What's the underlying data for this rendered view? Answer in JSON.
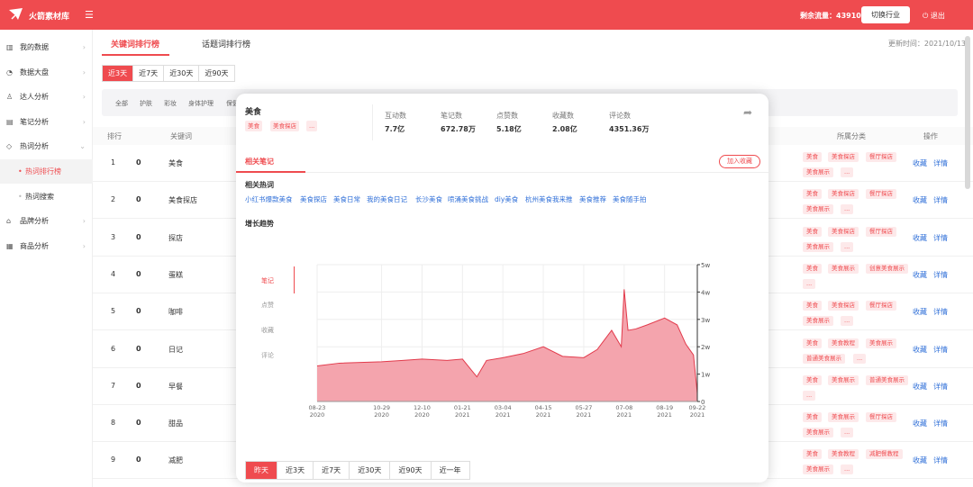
{
  "topbar": {
    "logo_text": "火箭素材库",
    "menu_icon": "☰",
    "credits": "剩余流量：43910",
    "switch": "切换行业",
    "logout": "退出"
  },
  "sidebar": {
    "items": [
      {
        "icon": "bar-chart-icon",
        "label": "我的数据"
      },
      {
        "icon": "pie-icon",
        "label": "数据大盘"
      },
      {
        "icon": "user-icon",
        "label": "达人分析"
      },
      {
        "icon": "note-icon",
        "label": "笔记分析"
      },
      {
        "icon": "tag-icon",
        "label": "热词分析"
      },
      {
        "icon": "",
        "label": "热词排行榜"
      },
      {
        "icon": "",
        "label": "热词搜索"
      },
      {
        "icon": "brand-icon",
        "label": "品牌分析"
      },
      {
        "icon": "shop-icon",
        "label": "商品分析"
      }
    ]
  },
  "tabs": [
    "关键词排行榜",
    "话题词排行榜"
  ],
  "update_time": "更新时间：2021/10/13",
  "ranges": [
    "近3天",
    "近7天",
    "近30天",
    "近90天"
  ],
  "categories": [
    "全部",
    "护肤",
    "彩妆",
    "身体护理",
    "保健"
  ],
  "table": {
    "headers": {
      "rank": "排行",
      "keyword": "关键词",
      "category": "所属分类",
      "op": "操作"
    },
    "rows": [
      {
        "rank": "1",
        "change": "0",
        "keyword": "美食",
        "tags": [
          "美食",
          "美食探店",
          "餐厅探店",
          "美食展示",
          "..."
        ]
      },
      {
        "rank": "2",
        "change": "0",
        "keyword": "美食探店",
        "tags": [
          "美食",
          "美食探店",
          "餐厅探店",
          "美食展示",
          "..."
        ]
      },
      {
        "rank": "3",
        "change": "0",
        "keyword": "探店",
        "tags": [
          "美食",
          "美食探店",
          "餐厅探店",
          "美食展示",
          "..."
        ]
      },
      {
        "rank": "4",
        "change": "0",
        "keyword": "蛋糕",
        "tags": [
          "美食",
          "美食展示",
          "创意美食展示",
          "..."
        ]
      },
      {
        "rank": "5",
        "change": "0",
        "keyword": "咖啡",
        "tags": [
          "美食",
          "美食探店",
          "餐厅探店",
          "美食展示",
          "..."
        ]
      },
      {
        "rank": "6",
        "change": "0",
        "keyword": "日记",
        "tags": [
          "美食",
          "美食教程",
          "美食展示",
          "普通美食展示",
          "..."
        ]
      },
      {
        "rank": "7",
        "change": "0",
        "keyword": "早餐",
        "tags": [
          "美食",
          "美食展示",
          "普通美食展示",
          "..."
        ]
      },
      {
        "rank": "8",
        "change": "0",
        "keyword": "甜品",
        "tags": [
          "美食",
          "美食展示",
          "餐厅探店",
          "美食展示",
          "..."
        ]
      },
      {
        "rank": "9",
        "change": "0",
        "keyword": "减肥",
        "tags": [
          "美食",
          "美食教程",
          "减肥餐教程",
          "美食展示",
          "..."
        ]
      }
    ],
    "op_fav": "收藏",
    "op_detail": "详情"
  },
  "overlay": {
    "title": "美食",
    "tags": [
      "美食",
      "美食探店",
      "..."
    ],
    "stats": [
      {
        "label": "互动数",
        "value": "7.7亿"
      },
      {
        "label": "笔记数",
        "value": "672.78万"
      },
      {
        "label": "点赞数",
        "value": "5.18亿"
      },
      {
        "label": "收藏数",
        "value": "2.08亿"
      },
      {
        "label": "评论数",
        "value": "4351.36万"
      }
    ],
    "section_tab": "相关笔记",
    "add_fav": "加入收藏",
    "hot_title": "相关热词",
    "hot_words": [
      "小红书爆款美食",
      "美食探店",
      "美食日常",
      "我的美食日记",
      "长沙美食",
      "喷涌美食挑战",
      "diy美食",
      "杭州美食我来推",
      "美食推荐",
      "美食随手拍"
    ],
    "trend_title": "增长趋势",
    "metrics": [
      "笔记",
      "点赞",
      "收藏",
      "评论"
    ],
    "bottom_ranges": [
      "昨天",
      "近3天",
      "近7天",
      "近30天",
      "近90天",
      "近一年"
    ]
  },
  "chart_data": {
    "type": "area",
    "color": "#f4a4ad",
    "line_color": "#e23b4c",
    "x_ticks": [
      {
        "d": "08-23",
        "y": "2020"
      },
      {
        "d": "10-29",
        "y": "2020"
      },
      {
        "d": "12-10",
        "y": "2020"
      },
      {
        "d": "01-21",
        "y": "2021"
      },
      {
        "d": "03-04",
        "y": "2021"
      },
      {
        "d": "04-15",
        "y": "2021"
      },
      {
        "d": "05-27",
        "y": "2021"
      },
      {
        "d": "07-08",
        "y": "2021"
      },
      {
        "d": "08-19",
        "y": "2021"
      },
      {
        "d": "09-22",
        "y": "2021"
      }
    ],
    "y_ticks": [
      "0",
      "1w",
      "2w",
      "3w",
      "4w",
      "5w"
    ],
    "ylim": [
      0,
      50000
    ],
    "x": [
      "2020-08-23",
      "2020-09-15",
      "2020-10-29",
      "2020-11-20",
      "2020-12-10",
      "2021-01-05",
      "2021-01-21",
      "2021-02-05",
      "2021-02-15",
      "2021-03-04",
      "2021-03-25",
      "2021-04-15",
      "2021-05-05",
      "2021-05-27",
      "2021-06-10",
      "2021-06-25",
      "2021-07-05",
      "2021-07-08",
      "2021-07-12",
      "2021-07-20",
      "2021-08-01",
      "2021-08-19",
      "2021-09-01",
      "2021-09-10",
      "2021-09-18",
      "2021-09-22"
    ],
    "values": [
      13000,
      14000,
      14500,
      15000,
      15500,
      15000,
      15500,
      9000,
      15000,
      16000,
      17500,
      20000,
      16500,
      16000,
      19000,
      26000,
      20000,
      41000,
      26000,
      26500,
      28000,
      30500,
      28000,
      21000,
      17000,
      3000
    ]
  }
}
